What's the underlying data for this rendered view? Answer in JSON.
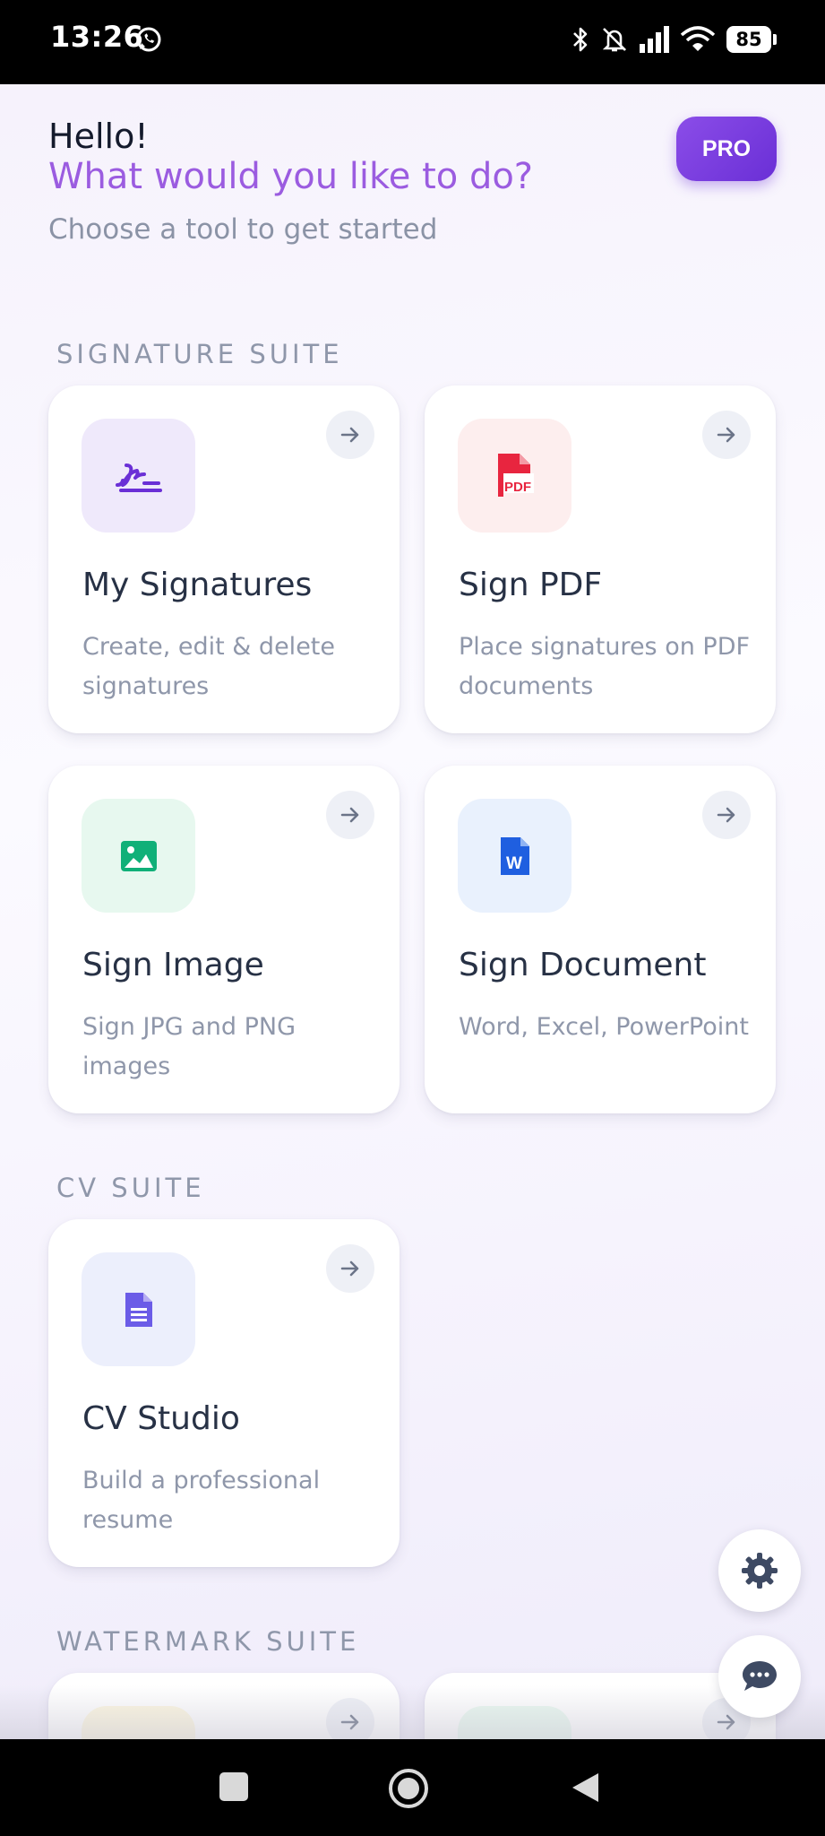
{
  "status_bar": {
    "time": "13:26",
    "battery": "85"
  },
  "header": {
    "greeting": "Hello!",
    "question": "What would you like to do?",
    "subtitle": "Choose a tool to get started",
    "pro_label": "PRO"
  },
  "sections": [
    {
      "title": "SIGNATURE SUITE"
    },
    {
      "title": "CV SUITE"
    },
    {
      "title": "WATERMARK SUITE"
    }
  ],
  "cards": [
    {
      "title": "My Signatures",
      "desc": "Create, edit & delete signatures",
      "icon": "signature-icon",
      "color": "#6a2fd6",
      "bg": "#efe9fb"
    },
    {
      "title": "Sign PDF",
      "desc": "Place signatures on PDF documents",
      "icon": "pdf-icon",
      "color": "#e8253f",
      "bg": "#fdeeee"
    },
    {
      "title": "Sign Image",
      "desc": "Sign JPG and PNG images",
      "icon": "image-icon",
      "color": "#10b078",
      "bg": "#e7f8ef"
    },
    {
      "title": "Sign Document",
      "desc": "Word, Excel, PowerPoint",
      "icon": "word-icon",
      "color": "#1f5fe0",
      "bg": "#e9f1fd"
    },
    {
      "title": "CV Studio",
      "desc": "Build a professional resume",
      "icon": "document-icon",
      "color": "#6b5ce7",
      "bg": "#eceffc"
    }
  ],
  "partial_cards": [
    {
      "icon_bg": "#fdf7e0"
    },
    {
      "icon_bg": "#e9f9f0"
    }
  ]
}
